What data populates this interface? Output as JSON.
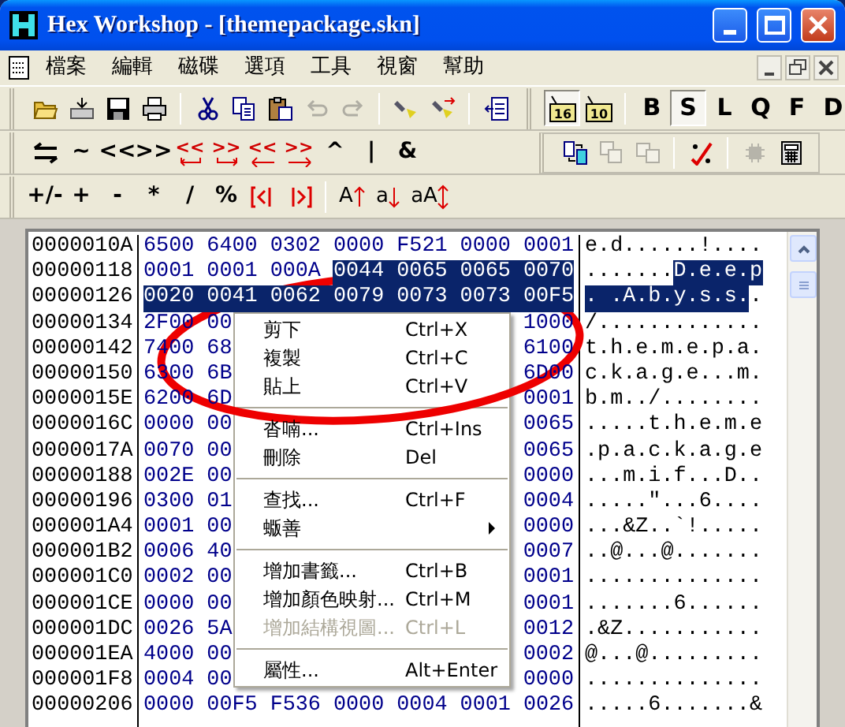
{
  "window": {
    "title": "Hex Workshop - [themepackage.skn]"
  },
  "menu_bar": [
    "檔案",
    "編輯",
    "磁碟",
    "選項",
    "工具",
    "視窗",
    "幫助"
  ],
  "toolbars": [
    {
      "items": [
        {
          "kind": "button",
          "disabled": false
        },
        {
          "kind": "button",
          "disabled": false
        },
        {
          "kind": "button",
          "disabled": false
        },
        {
          "kind": "button",
          "disabled": false
        },
        {
          "kind": "separator"
        },
        {
          "kind": "button",
          "disabled": false
        },
        {
          "kind": "button",
          "disabled": false
        },
        {
          "kind": "button",
          "disabled": false
        },
        {
          "kind": "button",
          "disabled": true
        },
        {
          "kind": "button",
          "disabled": true
        },
        {
          "kind": "separator"
        },
        {
          "kind": "button",
          "disabled": false
        },
        {
          "kind": "button",
          "disabled": false
        },
        {
          "kind": "separator"
        },
        {
          "kind": "button",
          "disabled": false
        }
      ]
    },
    {
      "items": [
        {
          "label": "16",
          "kind": "base",
          "pressed": true
        },
        {
          "label": "10",
          "kind": "base",
          "pressed": false
        },
        {
          "kind": "separator"
        },
        {
          "label": "B",
          "kind": "size",
          "pressed": false
        },
        {
          "label": "S",
          "kind": "size",
          "pressed": true
        },
        {
          "label": "L",
          "kind": "size",
          "pressed": false
        },
        {
          "label": "Q",
          "kind": "size",
          "pressed": false
        },
        {
          "label": "F",
          "kind": "size",
          "pressed": false
        },
        {
          "label": "D",
          "kind": "size",
          "pressed": false
        }
      ]
    },
    {
      "items": [
        {
          "kind": "icon"
        },
        {
          "label": "~",
          "kind": "plain"
        },
        {
          "label": "<<",
          "kind": "plain"
        },
        {
          "label": ">>",
          "kind": "plain"
        },
        {
          "label": "<<",
          "kind": "rotate-left"
        },
        {
          "label": ">>",
          "kind": "rotate-right"
        },
        {
          "label": "<<",
          "kind": "shift-left"
        },
        {
          "label": ">>",
          "kind": "shift-right"
        },
        {
          "label": "^",
          "kind": "plain"
        },
        {
          "label": "|",
          "kind": "plain"
        },
        {
          "label": "&",
          "kind": "plain"
        }
      ]
    },
    {
      "items": [
        {
          "kind": "button",
          "disabled": false
        },
        {
          "kind": "button",
          "disabled": true
        },
        {
          "kind": "button",
          "disabled": true
        },
        {
          "kind": "separator"
        },
        {
          "kind": "button",
          "disabled": false
        },
        {
          "kind": "separator"
        },
        {
          "kind": "button",
          "disabled": true
        },
        {
          "kind": "button",
          "disabled": false
        }
      ]
    },
    {
      "items": [
        {
          "label": "+/-",
          "kind": "plain"
        },
        {
          "label": "+",
          "kind": "plain"
        },
        {
          "label": "-",
          "kind": "plain"
        },
        {
          "label": "*",
          "kind": "plain"
        },
        {
          "label": "/",
          "kind": "plain"
        },
        {
          "label": "%",
          "kind": "plain"
        },
        {
          "kind": "block-left"
        },
        {
          "kind": "block-right"
        },
        {
          "kind": "separator"
        },
        {
          "label": "A",
          "kind": "case-up"
        },
        {
          "label": "a",
          "kind": "case-down"
        },
        {
          "label": "aA",
          "kind": "case-toggle"
        }
      ]
    }
  ],
  "hex_view": {
    "rows": [
      {
        "address": "0000010A",
        "left_words": [
          {
            "text": "6500",
            "selected": false
          },
          {
            "text": "6400",
            "selected": false
          },
          {
            "text": "0302",
            "selected": false
          },
          {
            "text": "0000",
            "selected": false
          },
          {
            "text": "F521",
            "selected": false
          },
          {
            "text": "0000",
            "selected": false
          },
          {
            "text": "0001",
            "selected": false
          }
        ],
        "ascii": [
          {
            "text": "e.d......!....",
            "selected": false
          }
        ]
      },
      {
        "address": "00000118",
        "left_words": [
          {
            "text": "0001",
            "selected": false
          },
          {
            "text": "0001",
            "selected": false
          },
          {
            "text": "000A",
            "selected": false
          },
          {
            "text": "0044",
            "selected": true
          },
          {
            "text": "0065",
            "selected": true
          },
          {
            "text": "0065",
            "selected": true
          },
          {
            "text": "0070",
            "selected": true
          }
        ],
        "ascii": [
          {
            "text": ".......",
            "selected": false
          },
          {
            "text": "D.e.e.p",
            "selected": true
          }
        ]
      },
      {
        "address": "00000126",
        "left_words": [
          {
            "text": "0020",
            "selected": true
          },
          {
            "text": "0041",
            "selected": true
          },
          {
            "text": "0062",
            "selected": true
          },
          {
            "text": "0079",
            "selected": true
          },
          {
            "text": "0073",
            "selected": true
          },
          {
            "text": "0073",
            "selected": true
          },
          {
            "text": "00F5",
            "selected": true
          }
        ],
        "ascii": [
          {
            "text": ". .A.b.y.s.s.",
            "selected": true
          },
          {
            "text": ".",
            "selected": false
          }
        ]
      },
      {
        "address": "00000134",
        "left_words": [
          {
            "text": "2F00",
            "selected": false
          },
          {
            "text": "00",
            "selected": false
          }
        ],
        "right_words": [
          {
            "text": "1000",
            "selected": false
          }
        ],
        "ascii": [
          {
            "text": "/.............",
            "selected": false
          }
        ]
      },
      {
        "address": "00000142",
        "left_words": [
          {
            "text": "7400",
            "selected": false
          },
          {
            "text": "68",
            "selected": false
          }
        ],
        "right_words": [
          {
            "text": "6100",
            "selected": false
          }
        ],
        "ascii": [
          {
            "text": "t.h.e.m.e.p.a.",
            "selected": false
          }
        ]
      },
      {
        "address": "00000150",
        "left_words": [
          {
            "text": "6300",
            "selected": false
          },
          {
            "text": "6B",
            "selected": false
          }
        ],
        "right_words": [
          {
            "text": "6D00",
            "selected": false
          }
        ],
        "ascii": [
          {
            "text": "c.k.a.g.e...m.",
            "selected": false
          }
        ]
      },
      {
        "address": "0000015E",
        "left_words": [
          {
            "text": "6200",
            "selected": false
          },
          {
            "text": "6D",
            "selected": false
          }
        ],
        "right_words": [
          {
            "text": "0001",
            "selected": false
          }
        ],
        "ascii": [
          {
            "text": "b.m../........",
            "selected": false
          }
        ]
      },
      {
        "address": "0000016C",
        "left_words": [
          {
            "text": "0000",
            "selected": false
          },
          {
            "text": "00",
            "selected": false
          }
        ],
        "right_words": [
          {
            "text": "0065",
            "selected": false
          }
        ],
        "ascii": [
          {
            "text": ".....t.h.e.m.e",
            "selected": false
          }
        ]
      },
      {
        "address": "0000017A",
        "left_words": [
          {
            "text": "0070",
            "selected": false
          },
          {
            "text": "00",
            "selected": false
          }
        ],
        "right_words": [
          {
            "text": "0065",
            "selected": false
          }
        ],
        "ascii": [
          {
            "text": ".p.a.c.k.a.g.e",
            "selected": false
          }
        ]
      },
      {
        "address": "00000188",
        "left_words": [
          {
            "text": "002E",
            "selected": false
          },
          {
            "text": "00",
            "selected": false
          }
        ],
        "right_words": [
          {
            "text": "0000",
            "selected": false
          }
        ],
        "ascii": [
          {
            "text": "...m.i.f...D..",
            "selected": false
          }
        ]
      },
      {
        "address": "00000196",
        "left_words": [
          {
            "text": "0300",
            "selected": false
          },
          {
            "text": "01",
            "selected": false
          }
        ],
        "right_words": [
          {
            "text": "0004",
            "selected": false
          }
        ],
        "ascii": [
          {
            "text": ".....\"...6....",
            "selected": false
          }
        ]
      },
      {
        "address": "000001A4",
        "left_words": [
          {
            "text": "0001",
            "selected": false
          },
          {
            "text": "00",
            "selected": false
          }
        ],
        "right_words": [
          {
            "text": "0000",
            "selected": false
          }
        ],
        "ascii": [
          {
            "text": "...&Z..`!.....",
            "selected": false
          }
        ]
      },
      {
        "address": "000001B2",
        "left_words": [
          {
            "text": "0006",
            "selected": false
          },
          {
            "text": "40",
            "selected": false
          }
        ],
        "right_words": [
          {
            "text": "0007",
            "selected": false
          }
        ],
        "ascii": [
          {
            "text": "..@...@.......",
            "selected": false
          }
        ]
      },
      {
        "address": "000001C0",
        "left_words": [
          {
            "text": "0002",
            "selected": false
          },
          {
            "text": "00",
            "selected": false
          }
        ],
        "right_words": [
          {
            "text": "0001",
            "selected": false
          }
        ],
        "ascii": [
          {
            "text": "..............",
            "selected": false
          }
        ]
      },
      {
        "address": "000001CE",
        "left_words": [
          {
            "text": "0000",
            "selected": false
          },
          {
            "text": "00",
            "selected": false
          }
        ],
        "right_words": [
          {
            "text": "0001",
            "selected": false
          }
        ],
        "ascii": [
          {
            "text": ".......6......",
            "selected": false
          }
        ]
      },
      {
        "address": "000001DC",
        "left_words": [
          {
            "text": "0026",
            "selected": false
          },
          {
            "text": "5A",
            "selected": false
          }
        ],
        "right_words": [
          {
            "text": "0012",
            "selected": false
          }
        ],
        "ascii": [
          {
            "text": ".&Z...........",
            "selected": false
          }
        ]
      },
      {
        "address": "000001EA",
        "left_words": [
          {
            "text": "4000",
            "selected": false
          },
          {
            "text": "00",
            "selected": false
          }
        ],
        "right_words": [
          {
            "text": "0002",
            "selected": false
          }
        ],
        "ascii": [
          {
            "text": "@...@.........",
            "selected": false
          }
        ]
      },
      {
        "address": "000001F8",
        "left_words": [
          {
            "text": "0004",
            "selected": false
          },
          {
            "text": "00",
            "selected": false
          }
        ],
        "right_words": [
          {
            "text": "0000",
            "selected": false
          }
        ],
        "ascii": [
          {
            "text": "..............",
            "selected": false
          }
        ]
      },
      {
        "address": "00000206",
        "left_words": [
          {
            "text": "0000",
            "selected": false
          },
          {
            "text": "00F5",
            "selected": false
          },
          {
            "text": "F536",
            "selected": false
          },
          {
            "text": "0000",
            "selected": false
          },
          {
            "text": "0004",
            "selected": false
          },
          {
            "text": "0001",
            "selected": false
          },
          {
            "text": "0026",
            "selected": false
          }
        ],
        "ascii": [
          {
            "text": ".....6.......&",
            "selected": false
          }
        ]
      }
    ]
  },
  "context_menu": {
    "items": [
      {
        "kind": "item",
        "label": "剪下",
        "shortcut": "Ctrl+X",
        "disabled": false
      },
      {
        "kind": "item",
        "label": "複製",
        "shortcut": "Ctrl+C",
        "disabled": false
      },
      {
        "kind": "item",
        "label": "貼上",
        "shortcut": "Ctrl+V",
        "disabled": false
      },
      {
        "kind": "separator"
      },
      {
        "kind": "item",
        "label": "沓喃...",
        "shortcut": "Ctrl+Ins",
        "disabled": false
      },
      {
        "kind": "item",
        "label": "刪除",
        "shortcut": "Del",
        "disabled": false
      },
      {
        "kind": "separator"
      },
      {
        "kind": "item",
        "label": "查找...",
        "shortcut": "Ctrl+F",
        "disabled": false
      },
      {
        "kind": "submenu",
        "label": "蝂善",
        "disabled": false
      },
      {
        "kind": "separator"
      },
      {
        "kind": "item",
        "label": "增加書籤...",
        "shortcut": "Ctrl+B",
        "disabled": false
      },
      {
        "kind": "item",
        "label": "增加顏色映射...",
        "shortcut": "Ctrl+M",
        "disabled": false
      },
      {
        "kind": "item",
        "label": "增加結構視圖...",
        "shortcut": "Ctrl+L",
        "disabled": true
      },
      {
        "kind": "separator"
      },
      {
        "kind": "item",
        "label": "屬性...",
        "shortcut": "Alt+Enter",
        "disabled": false
      }
    ]
  },
  "annotation": {
    "kind": "ellipse"
  }
}
